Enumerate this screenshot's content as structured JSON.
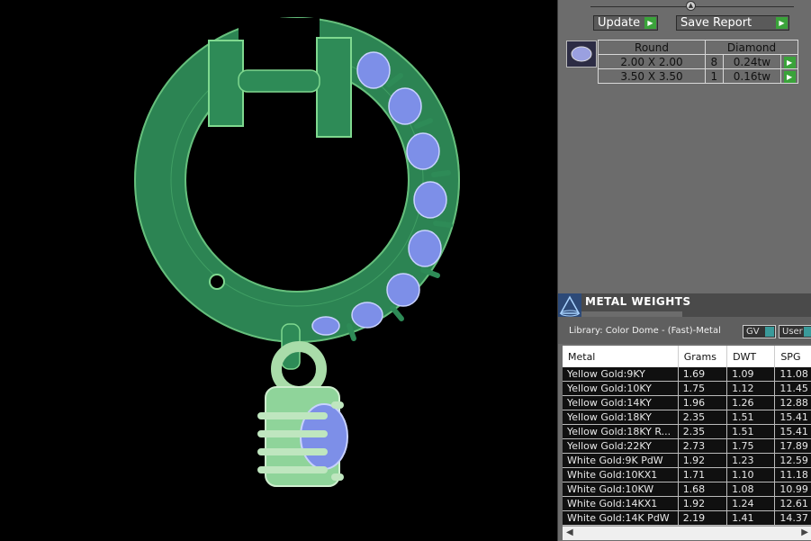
{
  "colors": {
    "metal": "#2e8b57",
    "metal_light": "#7fd88f",
    "stone": "#7d8fe8",
    "accent_green": "#3aa33a"
  },
  "toolbar": {
    "update_label": "Update",
    "save_report_label": "Save Report"
  },
  "stones": {
    "headers": [
      "Round",
      "Diamond"
    ],
    "rows": [
      {
        "size": "2.00 X 2.00",
        "count": "8",
        "weight": "0.24tw"
      },
      {
        "size": "3.50 X 3.50",
        "count": "1",
        "weight": "0.16tw"
      }
    ]
  },
  "metal_weights": {
    "title": "METAL WEIGHTS",
    "library": "Library: Color Dome - (Fast)-Metal",
    "gv_label": "GV",
    "user_label": "User",
    "columns": [
      "Metal",
      "Grams",
      "DWT",
      "SPG"
    ],
    "rows": [
      {
        "metal": "Yellow Gold:9KY",
        "grams": "1.69",
        "dwt": "1.09",
        "spg": "11.08"
      },
      {
        "metal": "Yellow Gold:10KY",
        "grams": "1.75",
        "dwt": "1.12",
        "spg": "11.45"
      },
      {
        "metal": "Yellow Gold:14KY",
        "grams": "1.96",
        "dwt": "1.26",
        "spg": "12.88"
      },
      {
        "metal": "Yellow Gold:18KY",
        "grams": "2.35",
        "dwt": "1.51",
        "spg": "15.41"
      },
      {
        "metal": "Yellow Gold:18KY R...",
        "grams": "2.35",
        "dwt": "1.51",
        "spg": "15.41"
      },
      {
        "metal": "Yellow Gold:22KY",
        "grams": "2.73",
        "dwt": "1.75",
        "spg": "17.89"
      },
      {
        "metal": "White Gold:9K PdW",
        "grams": "1.92",
        "dwt": "1.23",
        "spg": "12.59"
      },
      {
        "metal": "White Gold:10KX1",
        "grams": "1.71",
        "dwt": "1.10",
        "spg": "11.18"
      },
      {
        "metal": "White Gold:10KW",
        "grams": "1.68",
        "dwt": "1.08",
        "spg": "10.99"
      },
      {
        "metal": "White Gold:14KX1",
        "grams": "1.92",
        "dwt": "1.24",
        "spg": "12.61"
      },
      {
        "metal": "White Gold:14K PdW",
        "grams": "2.19",
        "dwt": "1.41",
        "spg": "14.37"
      }
    ]
  }
}
